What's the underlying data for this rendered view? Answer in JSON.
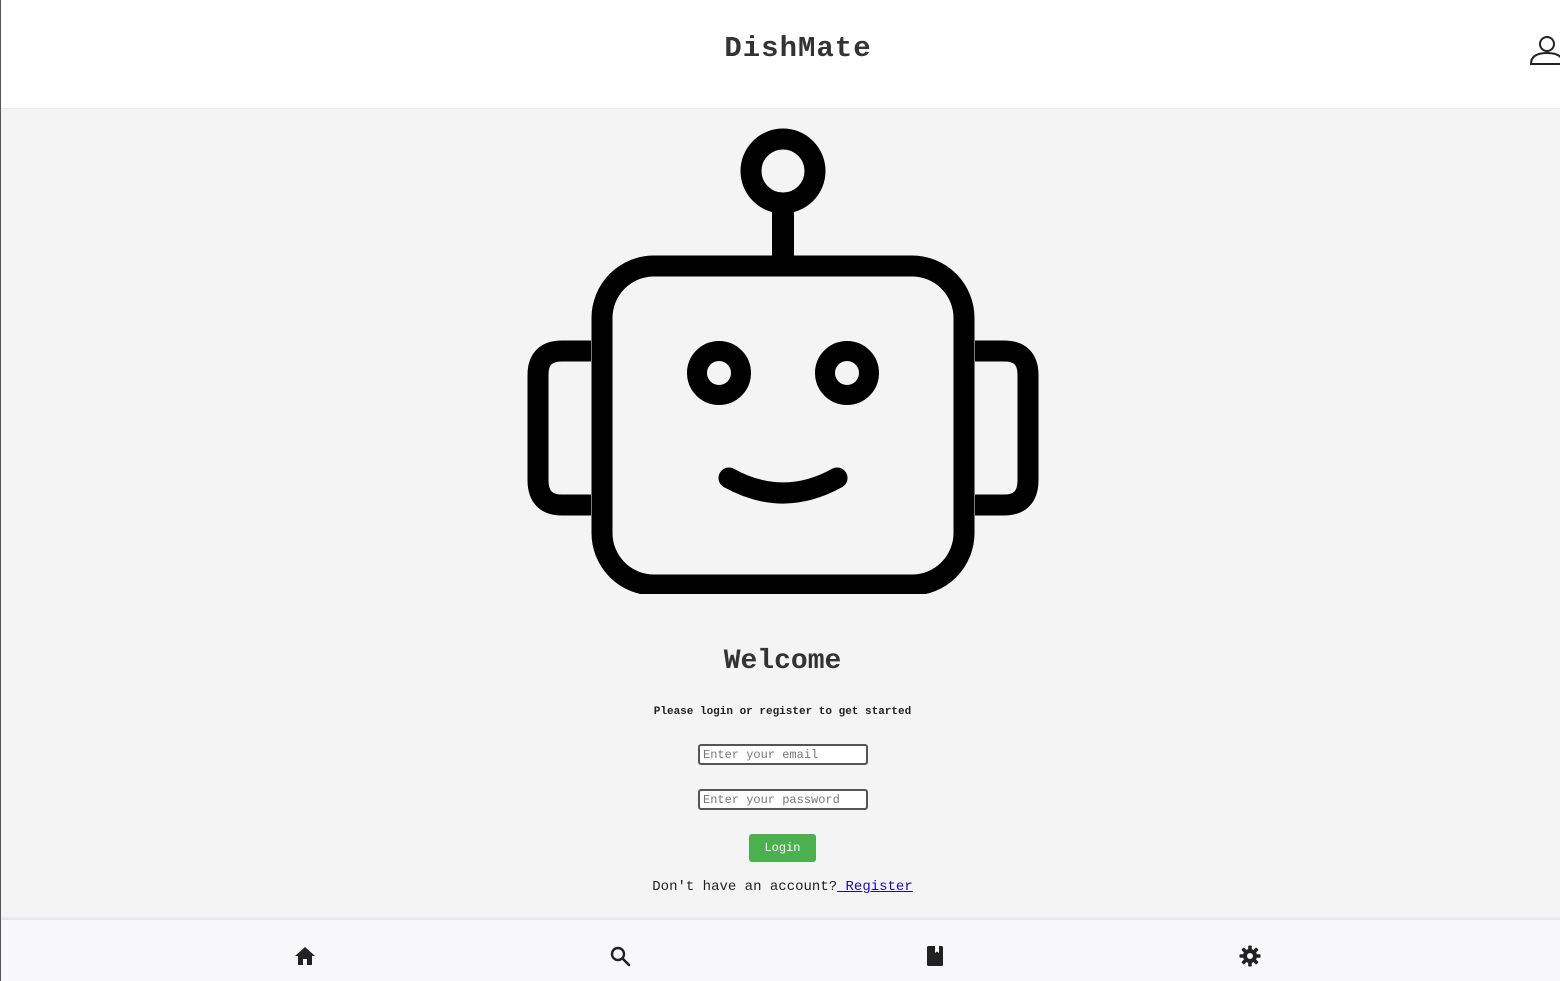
{
  "header": {
    "title": "DishMate",
    "profile_icon": "user-icon"
  },
  "welcome": {
    "heading": "Welcome",
    "subtitle": "Please login or register to get started"
  },
  "form": {
    "email_placeholder": "Enter your email",
    "email_value": "",
    "password_placeholder": "Enter your password",
    "password_value": "",
    "login_label": "Login",
    "register_prompt": "Don't have an account?",
    "register_link": " Register"
  },
  "colors": {
    "accent_green": "#4caf50",
    "link_blue": "#1a0dab",
    "background": "#f4f4f4"
  },
  "bottom_nav": {
    "items": [
      {
        "icon": "home-icon"
      },
      {
        "icon": "search-icon"
      },
      {
        "icon": "book-icon"
      },
      {
        "icon": "gear-icon"
      }
    ]
  }
}
